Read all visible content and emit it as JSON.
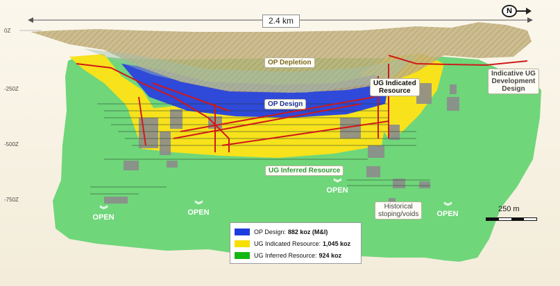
{
  "dimension": {
    "label": "2.4 km"
  },
  "north": {
    "label": "N"
  },
  "elevations": [
    "0Z",
    "-250Z",
    "-500Z",
    "-750Z"
  ],
  "labels": {
    "op_depletion": "OP Depletion",
    "op_design": "OP Design",
    "ug_indicated": "UG Indicated\nResource",
    "ug_inferred": "UG Inferred Resource",
    "indicative_ug": "Indicative UG\nDevelopment\nDesign",
    "historical": "Historical\nstoping/voids"
  },
  "open_label": "OPEN",
  "scale": {
    "label": "250 m"
  },
  "legend": [
    {
      "name": "OP Design:",
      "value": "882 koz (M&I)",
      "color": "#1e3be0"
    },
    {
      "name": "UG Indicated Resource:",
      "value": "1,045 koz",
      "color": "#f5e000"
    },
    {
      "name": "UG Inferred Resource:",
      "value": "924 koz",
      "color": "#14b814"
    }
  ],
  "colors": {
    "inferred": "#6fd67a",
    "indicated": "#f7e21c",
    "op_design": "#2f49d8",
    "depletion": "#c9b98a",
    "stoping": "#8c8c8c",
    "development": "#d01818"
  }
}
